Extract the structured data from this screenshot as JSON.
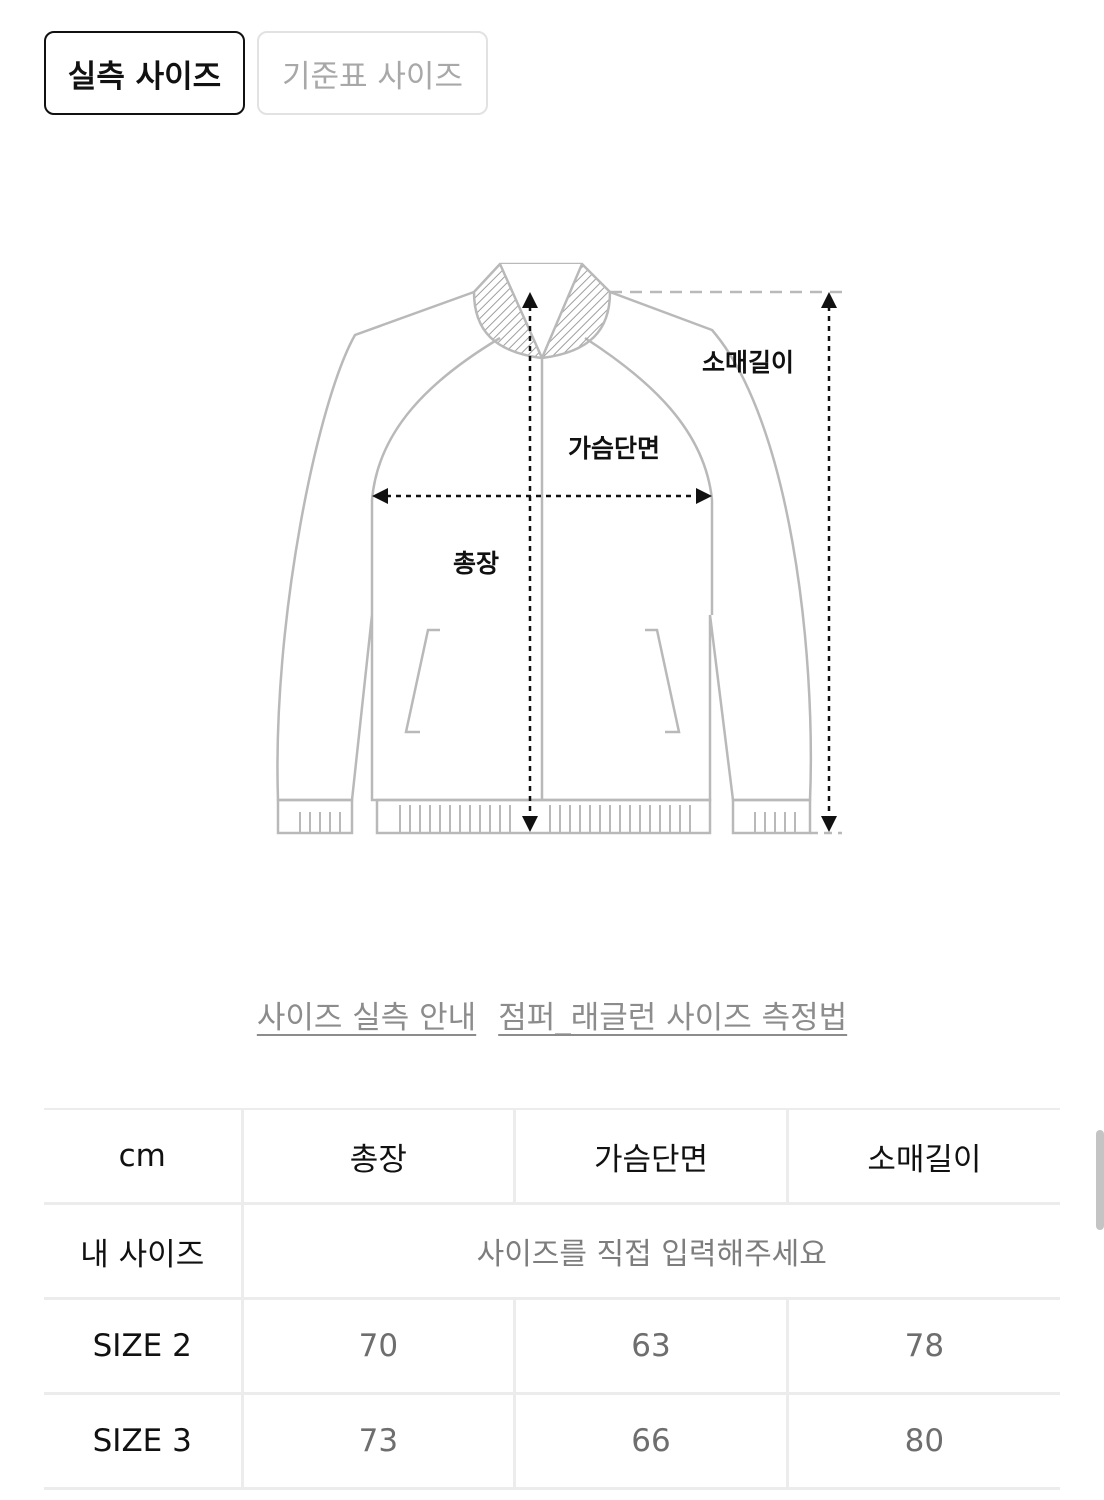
{
  "tabs": {
    "measured": "실측 사이즈",
    "standard": "기준표 사이즈"
  },
  "diagram": {
    "sleeve_label": "소매길이",
    "chest_label": "가슴단면",
    "length_label": "총장"
  },
  "links": {
    "guide": "사이즈 실측 안내",
    "method": "점퍼_래글런 사이즈 측정법"
  },
  "table": {
    "unit": "cm",
    "columns": [
      "총장",
      "가슴단면",
      "소매길이"
    ],
    "my_size_label": "내 사이즈",
    "my_size_hint": "사이즈를 직접 입력해주세요",
    "rows": [
      {
        "label": "SIZE 2",
        "values": [
          "70",
          "63",
          "78"
        ]
      },
      {
        "label": "SIZE 3",
        "values": [
          "73",
          "66",
          "80"
        ]
      }
    ]
  }
}
